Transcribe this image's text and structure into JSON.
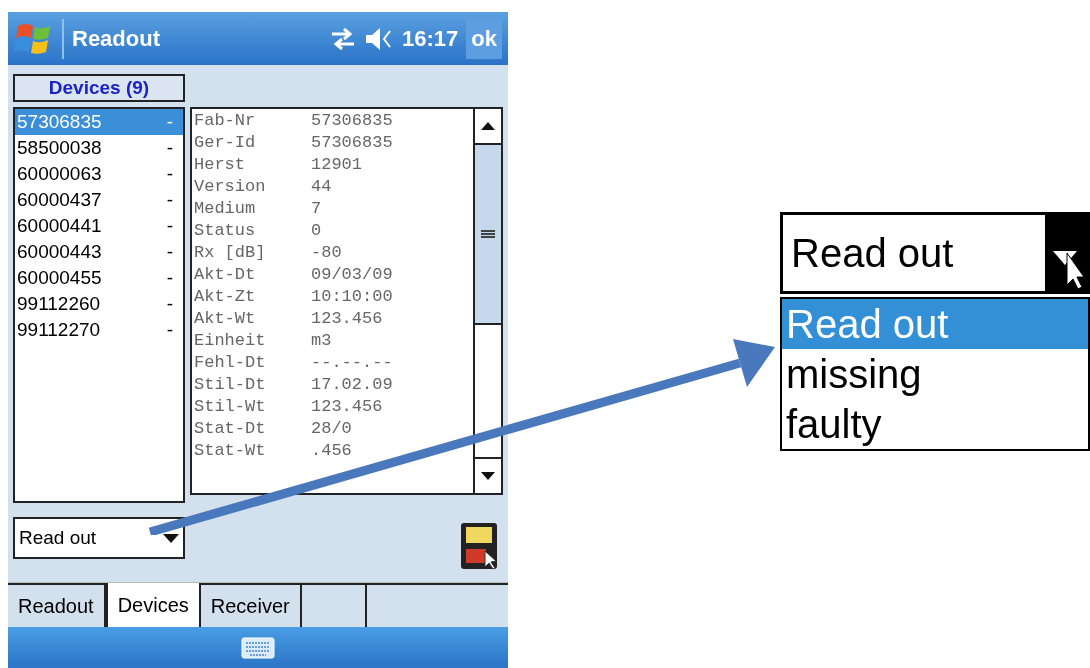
{
  "title_bar": {
    "title": "Readout",
    "time": "16:17",
    "ok": "ok"
  },
  "devices_header": "Devices (9)",
  "devices": [
    {
      "id": "57306835",
      "mark": "-",
      "selected": true
    },
    {
      "id": "58500038",
      "mark": "-",
      "selected": false
    },
    {
      "id": "60000063",
      "mark": "-",
      "selected": false
    },
    {
      "id": "60000437",
      "mark": "-",
      "selected": false
    },
    {
      "id": "60000441",
      "mark": "-",
      "selected": false
    },
    {
      "id": "60000443",
      "mark": "-",
      "selected": false
    },
    {
      "id": "60000455",
      "mark": "-",
      "selected": false
    },
    {
      "id": "99112260",
      "mark": "-",
      "selected": false
    },
    {
      "id": "99112270",
      "mark": "-",
      "selected": false
    }
  ],
  "details": [
    {
      "label": "Fab-Nr",
      "value": "57306835"
    },
    {
      "label": "Ger-Id",
      "value": "57306835"
    },
    {
      "label": "Herst",
      "value": "12901"
    },
    {
      "label": "Version",
      "value": "44"
    },
    {
      "label": "Medium",
      "value": "7"
    },
    {
      "label": "Status",
      "value": "0"
    },
    {
      "label": "Rx [dB]",
      "value": "-80"
    },
    {
      "label": "Akt-Dt",
      "value": "09/03/09"
    },
    {
      "label": "Akt-Zt",
      "value": "10:10:00"
    },
    {
      "label": "Akt-Wt",
      "value": "123.456"
    },
    {
      "label": "Einheit",
      "value": "m3"
    },
    {
      "label": "Fehl-Dt",
      "value": "--.--.--"
    },
    {
      "label": "Stil-Dt",
      "value": "17.02.09"
    },
    {
      "label": "Stil-Wt",
      "value": "123.456"
    },
    {
      "label": "Stat-Dt",
      "value": "28/0"
    },
    {
      "label": "Stat-Wt",
      "value": ".456"
    }
  ],
  "status_dropdown": {
    "value": "Read out"
  },
  "tabs": [
    {
      "label": "Readout",
      "selected": false
    },
    {
      "label": "Devices",
      "selected": true
    },
    {
      "label": "Receiver",
      "selected": false
    }
  ],
  "callout": {
    "value": "Read out",
    "options": [
      {
        "label": "Read out",
        "selected": true
      },
      {
        "label": "missing",
        "selected": false
      },
      {
        "label": "faulty",
        "selected": false
      }
    ]
  }
}
